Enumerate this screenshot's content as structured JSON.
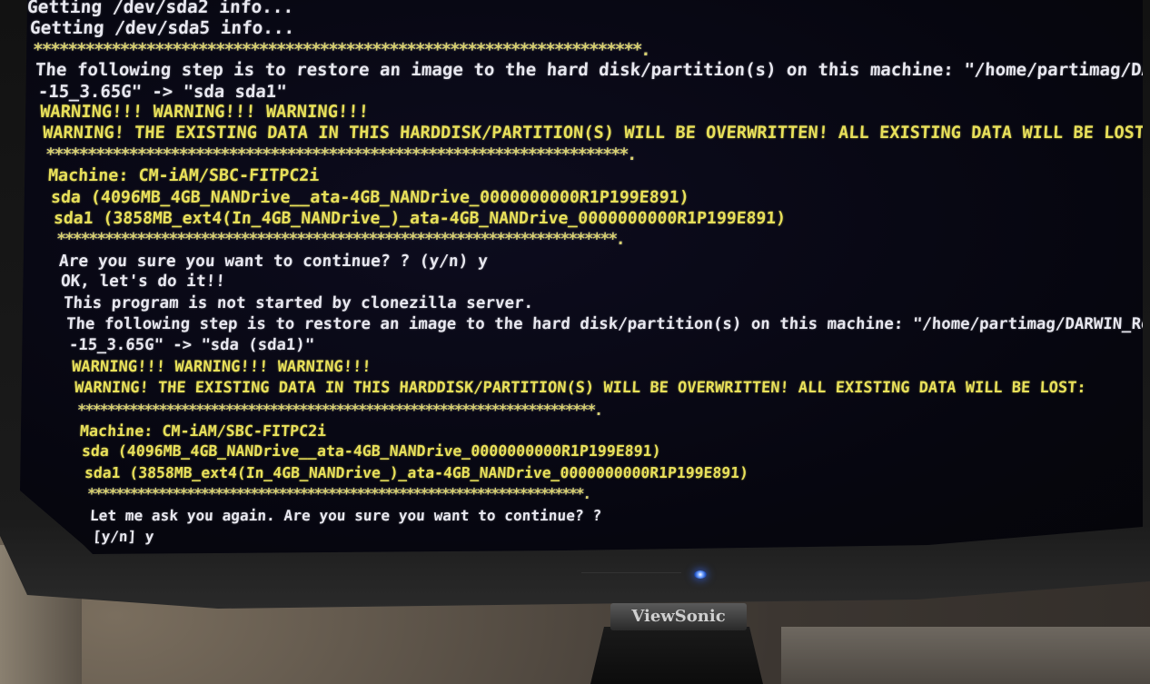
{
  "terminal": {
    "lines": [
      {
        "text": "Getting /dev/sda2 info...",
        "style": "normal"
      },
      {
        "text": "Getting /dev/sda5 info...",
        "style": "normal"
      },
      {
        "text": "**********************************************************************.",
        "style": "stars"
      },
      {
        "text": "The following step is to restore an image to the hard disk/partition(s) on this machine: \"/home/partimag/DARWI",
        "style": "normal"
      },
      {
        "text": "-15_3.65G\" -> \"sda sda1\"",
        "style": "normal"
      },
      {
        "text": "WARNING!!! WARNING!!! WARNING!!!",
        "style": "yellow"
      },
      {
        "text": "WARNING! THE EXISTING DATA IN THIS HARDDISK/PARTITION(S) WILL BE OVERWRITTEN! ALL EXISTING DATA WILL BE LOST:",
        "style": "yellow"
      },
      {
        "text": "**********************************************************************.",
        "style": "stars"
      },
      {
        "text": "Machine: CM-iAM/SBC-FITPC2i",
        "style": "yellow"
      },
      {
        "text": "sda (4096MB_4GB_NANDrive__ata-4GB_NANDrive_0000000000R1P199E891)",
        "style": "yellow"
      },
      {
        "text": "sda1 (3858MB_ext4(In_4GB_NANDrive_)_ata-4GB_NANDrive_0000000000R1P199E891)",
        "style": "yellow"
      },
      {
        "text": "**********************************************************************.",
        "style": "stars"
      },
      {
        "text": "Are you sure you want to continue? ? (y/n) y",
        "style": "normal"
      },
      {
        "text": "OK, let's do it!!",
        "style": "normal"
      },
      {
        "text": "This program is not started by clonezilla server.",
        "style": "normal"
      },
      {
        "text": "The following step is to restore an image to the hard disk/partition(s) on this machine: \"/home/partimag/DARWIN_Rec",
        "style": "normal"
      },
      {
        "text": "-15_3.65G\" -> \"sda (sda1)\"",
        "style": "normal"
      },
      {
        "text": "WARNING!!! WARNING!!! WARNING!!!",
        "style": "yellow"
      },
      {
        "text": "WARNING! THE EXISTING DATA IN THIS HARDDISK/PARTITION(S) WILL BE OVERWRITTEN! ALL EXISTING DATA WILL BE LOST:",
        "style": "yellow"
      },
      {
        "text": "**********************************************************************.",
        "style": "stars"
      },
      {
        "text": "Machine: CM-iAM/SBC-FITPC2i",
        "style": "yellow"
      },
      {
        "text": "sda (4096MB_4GB_NANDrive__ata-4GB_NANDrive_0000000000R1P199E891)",
        "style": "yellow"
      },
      {
        "text": "sda1 (3858MB_ext4(In_4GB_NANDrive_)_ata-4GB_NANDrive_0000000000R1P199E891)",
        "style": "yellow"
      },
      {
        "text": "**********************************************************************.",
        "style": "stars"
      },
      {
        "text": "Let me ask you again. Are you sure you want to continue? ?",
        "style": "normal"
      },
      {
        "text": "[y/n] y",
        "style": "normal"
      }
    ]
  },
  "monitor": {
    "brand": "ViewSonic",
    "power_led_color": "#3a6cff"
  },
  "colors": {
    "terminal_bg": "#06060f",
    "text_white": "#e8e8f0",
    "text_yellow": "#e8e05a"
  }
}
